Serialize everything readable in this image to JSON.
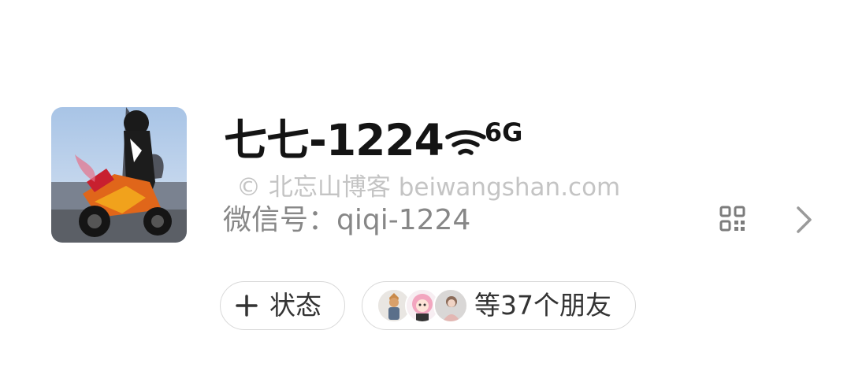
{
  "profile": {
    "nickname": "七七-1224",
    "network_label": "6G",
    "watermark": "© 北忘山博客 beiwangshan.com",
    "wechat_id": "微信号：qiqi-1224"
  },
  "actions": {
    "status_label": "状态",
    "friends_label": "等37个朋友"
  },
  "icons": {
    "signal": "wifi-signal-icon",
    "qr": "qr-code-icon",
    "chevron": "chevron-right-icon",
    "plus": "plus-icon"
  },
  "colors": {
    "text_primary": "#141414",
    "text_secondary": "#878787",
    "watermark": "#c4c4c4",
    "pill_border": "#d8d8d8"
  }
}
